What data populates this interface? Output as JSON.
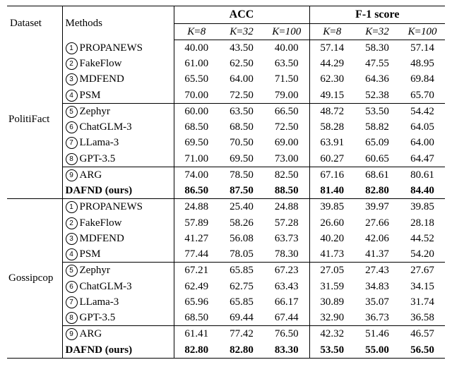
{
  "chart_data": {
    "type": "table",
    "header": {
      "dataset": "Dataset",
      "methods": "Methods",
      "metrics": [
        "ACC",
        "F-1 score"
      ],
      "kvalues": [
        "8",
        "32",
        "100"
      ]
    },
    "datasets": [
      {
        "name": "PolitiFact",
        "groups": [
          {
            "rows": [
              {
                "num": 1,
                "name": "PROPANEWS",
                "acc": [
                  "40.00",
                  "43.50",
                  "40.00"
                ],
                "f1": [
                  "57.14",
                  "58.30",
                  "57.14"
                ]
              },
              {
                "num": 2,
                "name": "FakeFlow",
                "acc": [
                  "61.00",
                  "62.50",
                  "63.50"
                ],
                "f1": [
                  "44.29",
                  "47.55",
                  "48.95"
                ]
              },
              {
                "num": 3,
                "name": "MDFEND",
                "acc": [
                  "65.50",
                  "64.00",
                  "71.50"
                ],
                "f1": [
                  "62.30",
                  "64.36",
                  "69.84"
                ]
              },
              {
                "num": 4,
                "name": "PSM",
                "acc": [
                  "70.00",
                  "72.50",
                  "79.00"
                ],
                "f1": [
                  "49.15",
                  "52.38",
                  "65.70"
                ]
              }
            ]
          },
          {
            "rows": [
              {
                "num": 5,
                "name": "Zephyr",
                "acc": [
                  "60.00",
                  "63.50",
                  "66.50"
                ],
                "f1": [
                  "48.72",
                  "53.50",
                  "54.42"
                ]
              },
              {
                "num": 6,
                "name": "ChatGLM-3",
                "acc": [
                  "68.50",
                  "68.50",
                  "72.50"
                ],
                "f1": [
                  "58.28",
                  "58.82",
                  "64.05"
                ]
              },
              {
                "num": 7,
                "name": "LLama-3",
                "acc": [
                  "69.50",
                  "70.50",
                  "69.00"
                ],
                "f1": [
                  "63.91",
                  "65.09",
                  "64.00"
                ]
              },
              {
                "num": 8,
                "name": "GPT-3.5",
                "acc": [
                  "71.00",
                  "69.50",
                  "73.00"
                ],
                "f1": [
                  "60.27",
                  "60.65",
                  "64.47"
                ]
              }
            ]
          },
          {
            "rows": [
              {
                "num": 9,
                "name": "ARG",
                "acc": [
                  "74.00",
                  "78.50",
                  "82.50"
                ],
                "f1": [
                  "67.16",
                  "68.61",
                  "80.61"
                ]
              },
              {
                "bold": true,
                "name": "DAFND (ours)",
                "acc": [
                  "86.50",
                  "87.50",
                  "88.50"
                ],
                "f1": [
                  "81.40",
                  "82.80",
                  "84.40"
                ]
              }
            ]
          }
        ]
      },
      {
        "name": "Gossipcop",
        "groups": [
          {
            "rows": [
              {
                "num": 1,
                "name": "PROPANEWS",
                "acc": [
                  "24.88",
                  "25.40",
                  "24.88"
                ],
                "f1": [
                  "39.85",
                  "39.97",
                  "39.85"
                ]
              },
              {
                "num": 2,
                "name": "FakeFlow",
                "acc": [
                  "57.89",
                  "58.26",
                  "57.28"
                ],
                "f1": [
                  "26.60",
                  "27.66",
                  "28.18"
                ]
              },
              {
                "num": 3,
                "name": "MDFEND",
                "acc": [
                  "41.27",
                  "56.08",
                  "63.73"
                ],
                "f1": [
                  "40.20",
                  "42.06",
                  "44.52"
                ]
              },
              {
                "num": 4,
                "name": "PSM",
                "acc": [
                  "77.44",
                  "78.05",
                  "78.30"
                ],
                "f1": [
                  "41.73",
                  "41.37",
                  "54.20"
                ]
              }
            ]
          },
          {
            "rows": [
              {
                "num": 5,
                "name": "Zephyr",
                "acc": [
                  "67.21",
                  "65.85",
                  "67.23"
                ],
                "f1": [
                  "27.05",
                  "27.43",
                  "27.67"
                ]
              },
              {
                "num": 6,
                "name": "ChatGLM-3",
                "acc": [
                  "62.49",
                  "62.75",
                  "63.43"
                ],
                "f1": [
                  "31.59",
                  "34.83",
                  "34.15"
                ]
              },
              {
                "num": 7,
                "name": "LLama-3",
                "acc": [
                  "65.96",
                  "65.85",
                  "66.17"
                ],
                "f1": [
                  "30.89",
                  "35.07",
                  "31.74"
                ]
              },
              {
                "num": 8,
                "name": "GPT-3.5",
                "acc": [
                  "68.50",
                  "69.44",
                  "67.44"
                ],
                "f1": [
                  "32.90",
                  "36.73",
                  "36.58"
                ]
              }
            ]
          },
          {
            "rows": [
              {
                "num": 9,
                "name": "ARG",
                "acc": [
                  "61.41",
                  "77.42",
                  "76.50"
                ],
                "f1": [
                  "42.32",
                  "51.46",
                  "46.57"
                ]
              },
              {
                "bold": true,
                "name": "DAFND (ours)",
                "acc": [
                  "82.80",
                  "82.80",
                  "83.30"
                ],
                "f1": [
                  "53.50",
                  "55.00",
                  "56.50"
                ]
              }
            ]
          }
        ]
      }
    ]
  }
}
